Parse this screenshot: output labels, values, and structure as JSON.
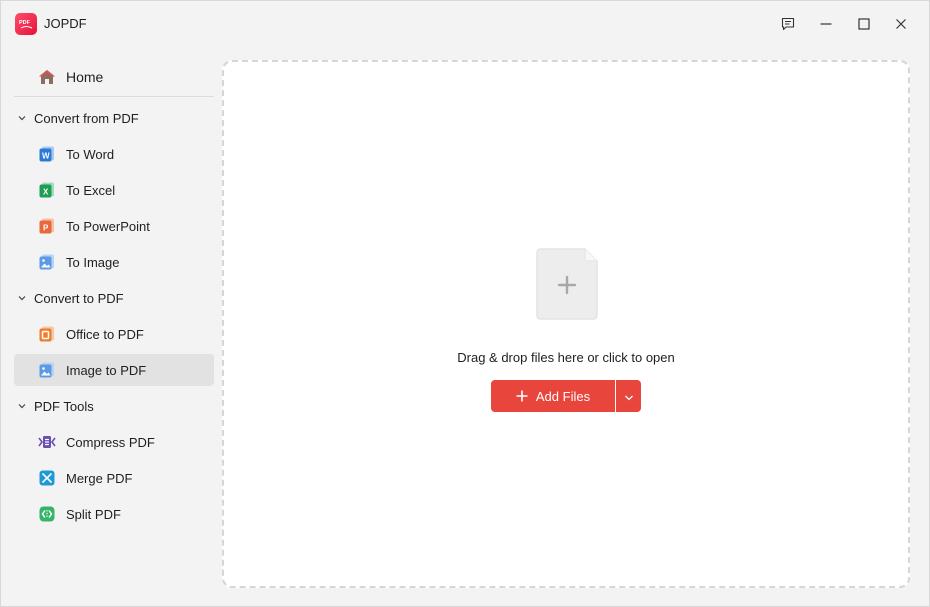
{
  "app": {
    "title": "JOPDF",
    "logo_text": "PDF",
    "accent": "#e8453c"
  },
  "window_controls": {
    "feedback_icon": "feedback-icon",
    "minimize_icon": "minimize-icon",
    "maximize_icon": "maximize-icon",
    "close_icon": "close-icon"
  },
  "sidebar": {
    "home": {
      "label": "Home",
      "icon": "home-icon"
    },
    "sections": [
      {
        "label": "Convert from PDF",
        "items": [
          {
            "label": "To Word",
            "icon": "word-icon"
          },
          {
            "label": "To Excel",
            "icon": "excel-icon"
          },
          {
            "label": "To PowerPoint",
            "icon": "powerpoint-icon"
          },
          {
            "label": "To Image",
            "icon": "image-icon"
          }
        ]
      },
      {
        "label": "Convert to PDF",
        "items": [
          {
            "label": "Office to PDF",
            "icon": "office-icon"
          },
          {
            "label": "Image to PDF",
            "icon": "image-icon",
            "active": true
          }
        ]
      },
      {
        "label": "PDF Tools",
        "items": [
          {
            "label": "Compress PDF",
            "icon": "compress-icon"
          },
          {
            "label": "Merge PDF",
            "icon": "merge-icon"
          },
          {
            "label": "Split PDF",
            "icon": "split-icon"
          }
        ]
      }
    ]
  },
  "main": {
    "drop_text": "Drag & drop files here or click to open",
    "add_button_label": "Add Files"
  }
}
